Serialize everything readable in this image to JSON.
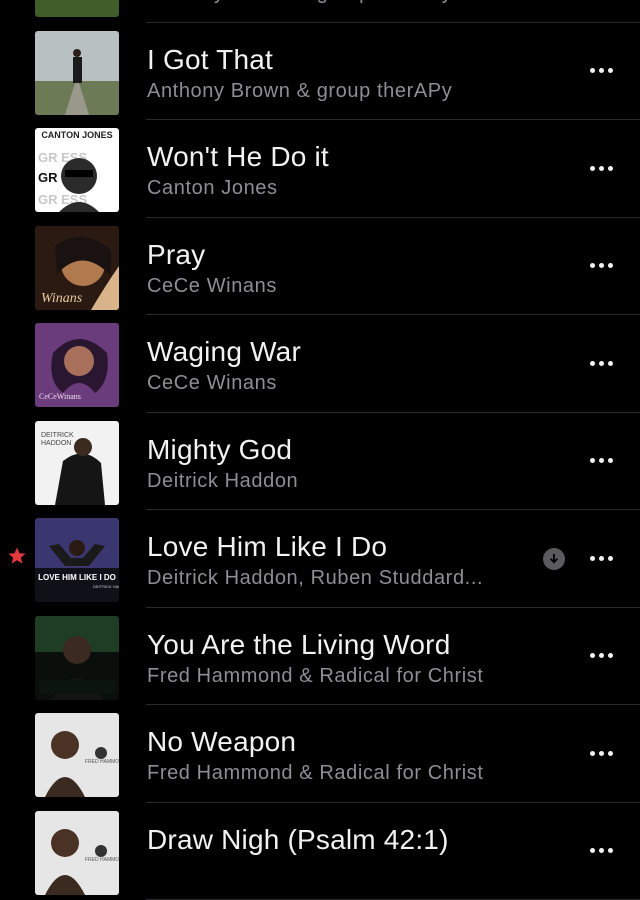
{
  "songs": [
    {
      "title": "",
      "artist": "Anthony Brown & group therAPy",
      "art_icon": "landscape-album-art",
      "colors": [
        "#7aa25a",
        "#3f5e2a"
      ]
    },
    {
      "title": "I Got That",
      "artist": "Anthony Brown & group therAPy",
      "art_icon": "man-on-road-album-art",
      "colors": [
        "#b9c0c2",
        "#6c7a56"
      ]
    },
    {
      "title": "Won't He Do it",
      "artist": "Canton Jones",
      "art_icon": "canton-jones-album-art",
      "art_text": "CANTON JONES",
      "colors": [
        "#ffffff",
        "#2b2b2b"
      ]
    },
    {
      "title": "Pray",
      "artist": "CeCe Winans",
      "art_icon": "cece-portrait-album-art",
      "art_text": "Winans",
      "colors": [
        "#d9b48a",
        "#1d1410"
      ]
    },
    {
      "title": "Waging War",
      "artist": "CeCe Winans",
      "art_icon": "purple-portrait-album-art",
      "art_text": "CeCeWinans",
      "colors": [
        "#6a3c7c",
        "#2a1630"
      ]
    },
    {
      "title": "Mighty God",
      "artist": "Deitrick Haddon",
      "art_icon": "deitrick-haddon-album-art",
      "art_text": "DEITRICK HADDON",
      "colors": [
        "#f2f2f2",
        "#151515"
      ]
    },
    {
      "title": "Love Him Like I Do",
      "artist": "Deitrick Haddon, Ruben Studdard...",
      "art_icon": "love-him-like-i-do-album-art",
      "art_text": "LOVE HIM LIKE I DO",
      "colors": [
        "#3a3670",
        "#101018"
      ],
      "starred": true,
      "downloadable": true
    },
    {
      "title": "You Are the Living Word",
      "artist": "Fred Hammond & Radical for Christ",
      "art_icon": "green-portrait-album-art",
      "colors": [
        "#1f3d24",
        "#0a0f0b"
      ]
    },
    {
      "title": "No Weapon",
      "artist": "Fred Hammond & Radical for Christ",
      "art_icon": "fred-hammond-album-art",
      "art_text": "FRED HAMMOND",
      "colors": [
        "#e6e6e6",
        "#3a2a20"
      ]
    },
    {
      "title": "Draw Nigh (Psalm 42:1)",
      "artist": "",
      "art_icon": "fred-hammond-album-art-2",
      "colors": [
        "#e6e6e6",
        "#3a2a20"
      ]
    }
  ],
  "accent": {
    "star": "#e03a3e"
  }
}
